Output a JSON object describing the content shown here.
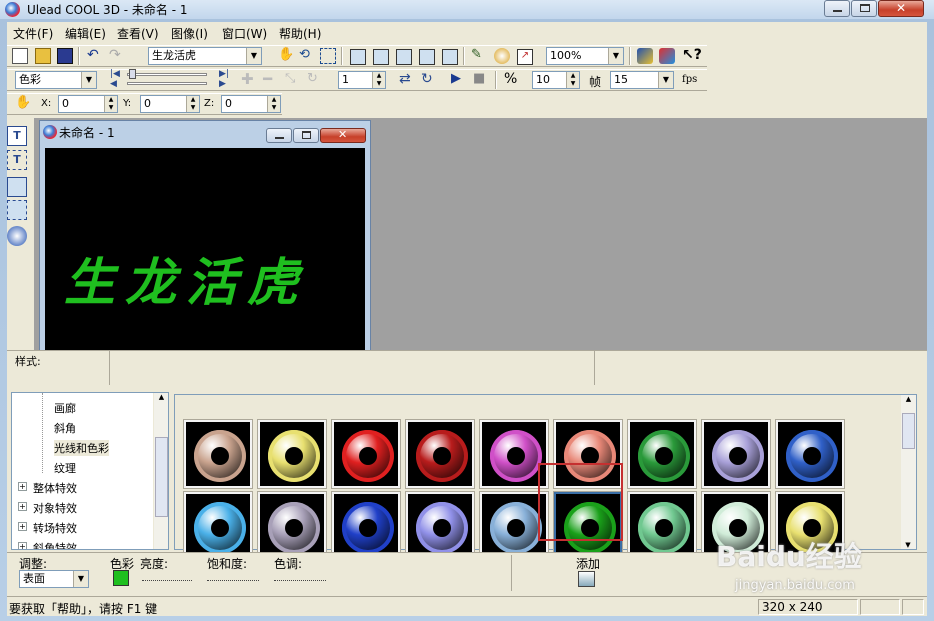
{
  "titlebar": {
    "title": "Ulead COOL 3D - 未命名 - 1"
  },
  "menu": [
    "文件(F)",
    "编辑(E)",
    "查看(V)",
    "图像(I)",
    "窗口(W)",
    "帮助(H)"
  ],
  "toolbar1": {
    "text_combo": "生龙活虎",
    "zoom_combo": "100%"
  },
  "toolbar2": {
    "attr_combo": "色彩",
    "frame_value": "1",
    "total_frames": "10",
    "frame_label": "帧",
    "fps_value": "15",
    "fps_label": "fps"
  },
  "toolbar3": {
    "x_label": "X:",
    "x_value": "0",
    "y_label": "Y:",
    "y_value": "0",
    "z_label": "Z:",
    "z_value": "0"
  },
  "doc": {
    "title": "未命名 - 1",
    "canvas_text": "生龙活虎",
    "canvas_text_color": "#1fbf1f"
  },
  "style_label": "样式:",
  "tree": {
    "children": [
      "画廊",
      "斜角",
      "光线和色彩",
      "纹理"
    ],
    "groups": [
      "整体特效",
      "对象特效",
      "转场特效",
      "斜角特效"
    ],
    "selected": "光线和色彩"
  },
  "gallery": {
    "row1": [
      "#c9a38e",
      "#e8e070",
      "#e02020",
      "#b81c1c",
      "#d050c8",
      "#e88878",
      "#2a9a3a",
      "#a8a0d8",
      "#3060c8"
    ],
    "row2": [
      "#4ab0e8",
      "#a8a0b8",
      "#2040c8",
      "#9090e8",
      "#88b0d8",
      "#1aa01a",
      "#70c890",
      "#d0ecd8",
      "#e8e070"
    ],
    "selected_index": 14
  },
  "bottom": {
    "adjust_label": "调整:",
    "adjust_value": "表面",
    "color_label": "色彩",
    "color_swatch": "#1fbf1f",
    "brightness_label": "亮度:",
    "saturation_label": "饱和度:",
    "hue_label": "色调:",
    "add_label": "添加"
  },
  "status": {
    "help_text": "要获取「帮助」，请按 F1 键",
    "size": "320 x 240"
  },
  "watermark": {
    "brand": "Baidu经验",
    "url": "jingyan.baidu.com"
  }
}
